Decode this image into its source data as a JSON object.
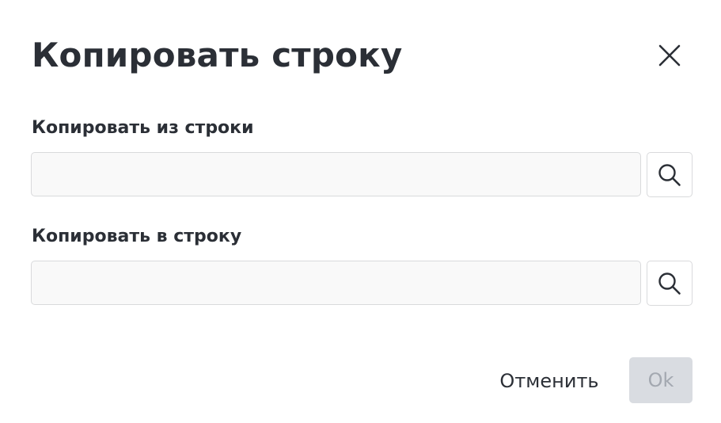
{
  "dialog": {
    "title": "Копировать строку",
    "close_icon": "close-icon"
  },
  "fields": {
    "from": {
      "label": "Копировать из строки",
      "value": "",
      "placeholder": "",
      "search_icon": "search-icon"
    },
    "to": {
      "label": "Копировать в строку",
      "value": "",
      "placeholder": "",
      "search_icon": "search-icon"
    }
  },
  "actions": {
    "cancel_label": "Отменить",
    "ok_label": "Ok",
    "ok_disabled": true
  },
  "colors": {
    "text": "#2b2f36",
    "input_background": "#f9f9f9",
    "input_border": "#d9dadc",
    "ok_disabled_background": "#d9dce1",
    "ok_disabled_text": "#a3a8b0"
  }
}
